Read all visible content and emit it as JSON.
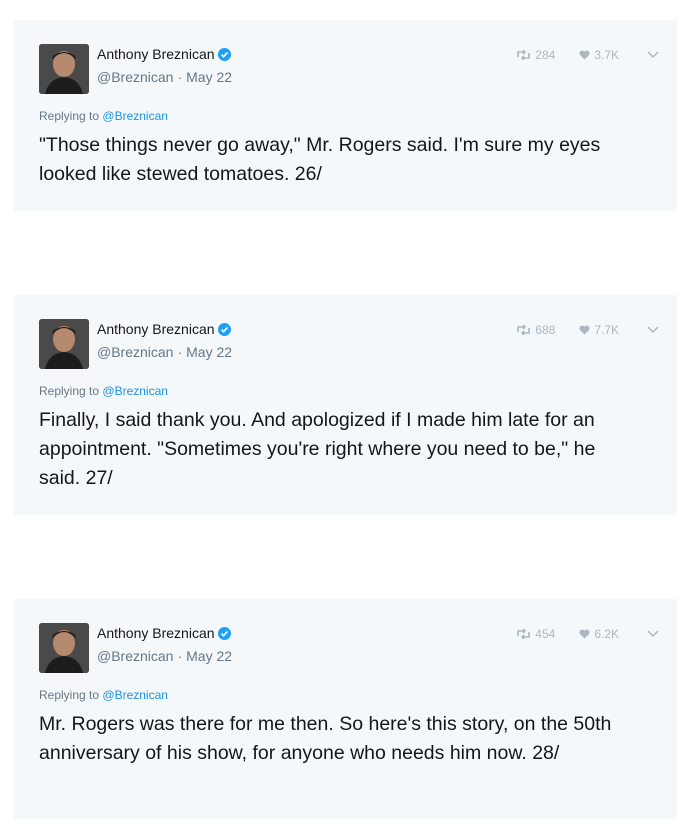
{
  "colors": {
    "card_bg": "#f5f8fa",
    "link": "#1b95e0",
    "muted": "#657786",
    "icon": "#aab8c2",
    "verified": "#1da1f2"
  },
  "tweets": [
    {
      "author_name": "Anthony Breznican",
      "handle": "@Breznican",
      "separator": "·",
      "date": "May 22",
      "retweets": "284",
      "likes": "3.7K",
      "replying_prefix": "Replying to",
      "replying_handle": "@Breznican",
      "text": "\"Those things never go away,\" Mr. Rogers said. I'm sure my eyes looked like stewed tomatoes. 26/"
    },
    {
      "author_name": "Anthony Breznican",
      "handle": "@Breznican",
      "separator": "·",
      "date": "May 22",
      "retweets": "688",
      "likes": "7.7K",
      "replying_prefix": "Replying to",
      "replying_handle": "@Breznican",
      "text": "Finally, I said thank you. And apologized if I made him late for an appointment. \"Sometimes you're right where you need to be,\" he said. 27/"
    },
    {
      "author_name": "Anthony Breznican",
      "handle": "@Breznican",
      "separator": "·",
      "date": "May 22",
      "retweets": "454",
      "likes": "6.2K",
      "replying_prefix": "Replying to",
      "replying_handle": "@Breznican",
      "text": "Mr. Rogers was there for me then. So here's this story, on the 50th anniversary of his show, for anyone who needs him now. 28/"
    }
  ]
}
